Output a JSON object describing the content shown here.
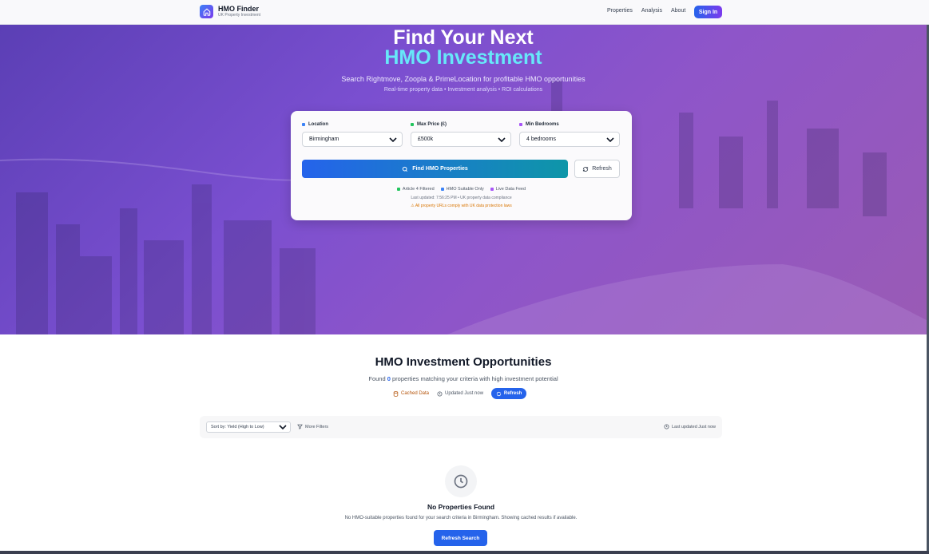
{
  "header": {
    "brand_name": "HMO Finder",
    "brand_tagline": "UK Property Investment",
    "nav": [
      "Properties",
      "Analysis",
      "About"
    ],
    "signin_label": "Sign In"
  },
  "hero": {
    "title_line1": "Find Your Next",
    "title_line2": "HMO Investment",
    "subtitle": "Search Rightmove, Zoopla & PrimeLocation for profitable HMO opportunities",
    "subtitle2": "Real-time property data • Investment analysis • ROI calculations"
  },
  "search": {
    "location": {
      "label": "Location",
      "value": "Birmingham"
    },
    "max_price": {
      "label": "Max Price (£)",
      "value": "£500k"
    },
    "min_bedrooms": {
      "label": "Min Bedrooms",
      "value": "4 bedrooms"
    },
    "find_label": "Find HMO Properties",
    "refresh_label": "Refresh",
    "badges": [
      "Article 4 Filtered",
      "HMO Suitable Only",
      "Live Data Feed"
    ],
    "last_updated": "Last updated: 7:56:25 PM • UK property data compliance",
    "compliance": "All property URLs comply with UK data protection laws"
  },
  "results": {
    "title": "HMO Investment Opportunities",
    "found_prefix": "Found",
    "count": "0",
    "found_suffix": "properties matching your criteria with high investment potential",
    "cached_label": "Cached Data",
    "updated_label": "Updated Just now",
    "refresh_label": "Refresh"
  },
  "filters": {
    "sort_value": "Sort by: Yield (High to Low)",
    "more_filters": "More Filters",
    "last_updated": "Last updated Just now"
  },
  "empty": {
    "title": "No Properties Found",
    "description": "No HMO-suitable properties found for your search criteria in Birmingham. Showing cached results if available.",
    "button": "Refresh Search"
  },
  "colors": {
    "accent": "#2563eb",
    "hero_title_accent": "#67e8f9",
    "warning": "#d97706"
  },
  "icons": [
    "home-icon",
    "chevron-down-icon",
    "search-icon",
    "refresh-icon",
    "database-icon",
    "clock-icon",
    "filter-icon",
    "warning-icon"
  ]
}
